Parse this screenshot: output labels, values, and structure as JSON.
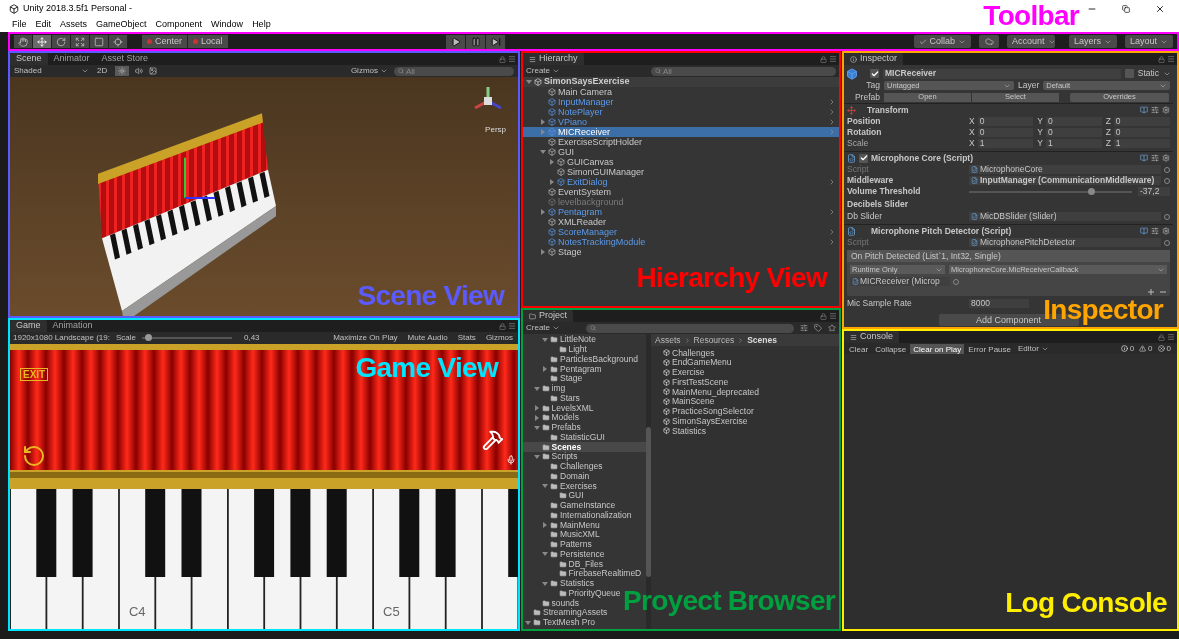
{
  "window": {
    "title": "Unity 2018.3.5f1 Personal -",
    "annotation": {
      "text": "Toolbar",
      "color": "#ff00ff"
    }
  },
  "menu": [
    "File",
    "Edit",
    "Assets",
    "GameObject",
    "Component",
    "Window",
    "Help"
  ],
  "toolbar": {
    "tools": [
      {
        "kind": "hand",
        "selected": false
      },
      {
        "kind": "move",
        "selected": true
      },
      {
        "kind": "rotate",
        "selected": false
      },
      {
        "kind": "scale",
        "selected": false
      },
      {
        "kind": "rect",
        "selected": false
      },
      {
        "kind": "transform",
        "selected": false
      }
    ],
    "pivot": [
      "Center",
      "Local"
    ],
    "playback": [
      {
        "kind": "play"
      },
      {
        "kind": "pause"
      },
      {
        "kind": "step"
      }
    ],
    "collab": "Collab",
    "account": "Account",
    "layers": "Layers",
    "layout": "Layout"
  },
  "scene": {
    "annotation": {
      "text": "Scene View",
      "color": "#5a5aff"
    },
    "tabs": [
      {
        "label": "Scene",
        "selected": true
      },
      {
        "label": "Animator",
        "selected": false
      },
      {
        "label": "Asset Store",
        "selected": false
      }
    ],
    "shading": "Shaded",
    "mode": "2D",
    "lighting_on": true,
    "gizmos": "Gizmos",
    "search_placeholder": "All",
    "projection": "Persp"
  },
  "game": {
    "annotation": {
      "text": "Game View",
      "color": "#00e5ff"
    },
    "tabs": [
      {
        "label": "Game",
        "selected": true
      },
      {
        "label": "Animation",
        "selected": false
      }
    ],
    "resolution": "1920x1080 Landscape (19:",
    "scale_label": "Scale",
    "scale": {
      "level": 0.03,
      "reading": "0,43"
    },
    "options": [
      "Maximize On Play",
      "Mute Audio",
      "Stats",
      "Gizmos"
    ],
    "exit_label": "EXIT",
    "key_labels": [
      "C4",
      "C5"
    ]
  },
  "hierarchy": {
    "annotation": {
      "text": "Hierarchy View",
      "color": "#ff0000"
    },
    "title": "Hierarchy",
    "create": "Create",
    "search_placeholder": "All",
    "scene": "SimonSaysExercise",
    "items": [
      {
        "label": "Main Camera",
        "prefab": false,
        "active": true,
        "selected": false
      },
      {
        "label": "InputManager",
        "prefab": true,
        "active": true,
        "selected": false
      },
      {
        "label": "NotePlayer",
        "prefab": true,
        "active": true,
        "selected": false
      },
      {
        "label": "VPiano",
        "prefab": true,
        "active": true,
        "selected": false,
        "expanded": false
      },
      {
        "label": "MICReceiver",
        "prefab": true,
        "active": true,
        "selected": true,
        "expanded": false
      },
      {
        "label": "ExerciseScriptHolder",
        "prefab": false,
        "active": true,
        "selected": false
      },
      {
        "label": "GUI",
        "prefab": false,
        "active": true,
        "selected": false,
        "expanded": true,
        "children": [
          {
            "label": "GUICanvas",
            "prefab": false,
            "active": true,
            "selected": false,
            "expanded": false
          },
          {
            "label": "SimonGUIManager",
            "prefab": false,
            "active": true,
            "selected": false
          },
          {
            "label": "ExitDialog",
            "prefab": true,
            "active": true,
            "selected": false,
            "expanded": false
          }
        ]
      },
      {
        "label": "EventSystem",
        "prefab": false,
        "active": true,
        "selected": false
      },
      {
        "label": "levelbackground",
        "prefab": false,
        "active": false,
        "selected": false
      },
      {
        "label": "Pentagram",
        "prefab": true,
        "active": true,
        "selected": false,
        "expanded": false
      },
      {
        "label": "XMLReader",
        "prefab": false,
        "active": true,
        "selected": false
      },
      {
        "label": "ScoreManager",
        "prefab": true,
        "active": true,
        "selected": false
      },
      {
        "label": "NotesTrackingModule",
        "prefab": true,
        "active": true,
        "selected": false
      },
      {
        "label": "Stage",
        "prefab": false,
        "active": true,
        "selected": false,
        "expanded": false
      }
    ]
  },
  "project": {
    "annotation": {
      "text": "Proyect Browser",
      "color": "#00a040"
    },
    "title": "Project",
    "create": "Create",
    "tree": [
      {
        "children": [
          {
            "children": [
              {
                "label": "LittleNote",
                "expanded": true,
                "selected": false,
                "children": [
                  {
                    "label": "Light",
                    "selected": false
                  }
                ]
              },
              {
                "label": "ParticlesBackground",
                "selected": false
              },
              {
                "label": "Pentagram",
                "expanded": false,
                "selected": false
              },
              {
                "label": "Stage",
                "selected": false
              }
            ]
          },
          {
            "label": "img",
            "expanded": true,
            "selected": false,
            "children": [
              {
                "label": "Stars",
                "selected": false
              }
            ]
          },
          {
            "label": "LevelsXML",
            "expanded": false,
            "selected": false
          },
          {
            "label": "Models",
            "expanded": false,
            "selected": false
          },
          {
            "label": "Prefabs",
            "expanded": true,
            "selected": false,
            "children": [
              {
                "label": "StatisticGUI",
                "selected": false
              }
            ]
          },
          {
            "label": "Scenes",
            "selected": true
          },
          {
            "label": "Scripts",
            "expanded": true,
            "selected": false,
            "children": [
              {
                "label": "Challenges",
                "selected": false
              },
              {
                "label": "Domain",
                "selected": false
              },
              {
                "label": "Exercises",
                "expanded": true,
                "selected": false,
                "children": [
                  {
                    "label": "GUI",
                    "selected": false
                  }
                ]
              },
              {
                "label": "GameInstance",
                "selected": false
              },
              {
                "label": "Internationalization",
                "selected": false
              },
              {
                "label": "MainMenu",
                "expanded": false,
                "selected": false
              },
              {
                "label": "MusicXML",
                "selected": false
              },
              {
                "label": "Patterns",
                "selected": false
              },
              {
                "label": "Persistence",
                "expanded": true,
                "selected": false,
                "children": [
                  {
                    "label": "DB_Files",
                    "selected": false
                  },
                  {
                    "label": "FirebaseRealtimeD",
                    "selected": false
                  }
                ]
              },
              {
                "label": "Statistics",
                "expanded": true,
                "selected": false,
                "children": [
                  {
                    "label": "PriorityQueue",
                    "selected": false
                  }
                ]
              }
            ]
          },
          {
            "label": "sounds",
            "selected": false
          }
        ]
      },
      {
        "label": "StreamingAssets",
        "selected": false
      },
      {
        "label": "TextMesh Pro",
        "expanded": true,
        "selected": false
      }
    ],
    "breadcrumb": [
      "Assets",
      "Resources",
      "Scenes"
    ],
    "files": [
      "Challenges",
      "EndGameMenu",
      "Exercise",
      "FirstTestScene",
      "MainMenu_deprecated",
      "MainScene",
      "PracticeSongSelector",
      "SimonSaysExercise",
      "Statistics"
    ]
  },
  "inspector": {
    "annotation": {
      "text": "Inspector",
      "color": "#ffa500"
    },
    "title": "Inspector",
    "object": {
      "active": true,
      "name": "MICReceiver",
      "static": {
        "label": "Static",
        "checked": false
      },
      "tag_label": "Tag",
      "tag": "Untagged",
      "layer_label": "Layer",
      "layer": "Default",
      "prefab_label": "Prefab",
      "prefab_buttons": [
        "Open",
        "Select",
        "Overrides"
      ]
    },
    "components": [
      {
        "kind": "transform",
        "title": "Transform",
        "rows": [
          {
            "label": "Position",
            "bold": true,
            "axes": [
              {
                "axis": "X",
                "value": "0"
              },
              {
                "axis": "Y",
                "value": "0"
              },
              {
                "axis": "Z",
                "value": "0"
              }
            ]
          },
          {
            "label": "Rotation",
            "bold": true,
            "axes": [
              {
                "axis": "X",
                "value": "0"
              },
              {
                "axis": "Y",
                "value": "0"
              },
              {
                "axis": "Z",
                "value": "0"
              }
            ]
          },
          {
            "label": "Scale",
            "bold": false,
            "axes": [
              {
                "axis": "X",
                "value": "1"
              },
              {
                "axis": "Y",
                "value": "1"
              },
              {
                "axis": "Z",
                "value": "1"
              }
            ]
          }
        ]
      },
      {
        "kind": "script",
        "title": "Microphone Core (Script)",
        "enabled": true,
        "fields": [
          {
            "kind": "object",
            "label": "Script",
            "value": "MicrophoneCore",
            "disabled": true,
            "bold": false
          },
          {
            "kind": "object",
            "label": "Middleware",
            "value": "InputManager (CommunicationMiddleware)",
            "disabled": false,
            "bold": true
          },
          {
            "kind": "slider",
            "label": "Volume Threshold",
            "level": 0.73,
            "reading": "-37,2",
            "bold": true
          },
          {
            "kind": "header",
            "label": "Decibels Slider"
          },
          {
            "kind": "object",
            "label": "Db Slider",
            "value": "MicDBSlider (Slider)",
            "disabled": false,
            "bold": false
          }
        ]
      },
      {
        "kind": "script",
        "title": "Microphone Pitch Detector (Script)",
        "fields": [
          {
            "kind": "object",
            "label": "Script",
            "value": "MicrophonePitchDetector",
            "disabled": true,
            "bold": false
          },
          {
            "kind": "event",
            "title": "On Pitch Detected (List`1, Int32, Single)",
            "runtime": "Runtime Only",
            "method": "MicrophoneCore.MicReceiverCallback",
            "target": "MICReceiver (Microp"
          },
          {
            "kind": "number",
            "label": "Mic Sample Rate",
            "value": "8000",
            "bold": false
          }
        ]
      }
    ],
    "add_component": "Add Component"
  },
  "console": {
    "annotation": {
      "text": "Log Console",
      "color": "#ffee00"
    },
    "title": "Console",
    "buttons": [
      {
        "label": "Clear",
        "on": false
      },
      {
        "label": "Collapse",
        "on": false
      },
      {
        "label": "Clear on Play",
        "on": true
      },
      {
        "label": "Error Pause",
        "on": false
      }
    ],
    "source": "Editor",
    "counts": [
      {
        "kind": "info",
        "value": "0"
      },
      {
        "kind": "warning",
        "value": "0"
      },
      {
        "kind": "error",
        "value": "0"
      }
    ]
  }
}
